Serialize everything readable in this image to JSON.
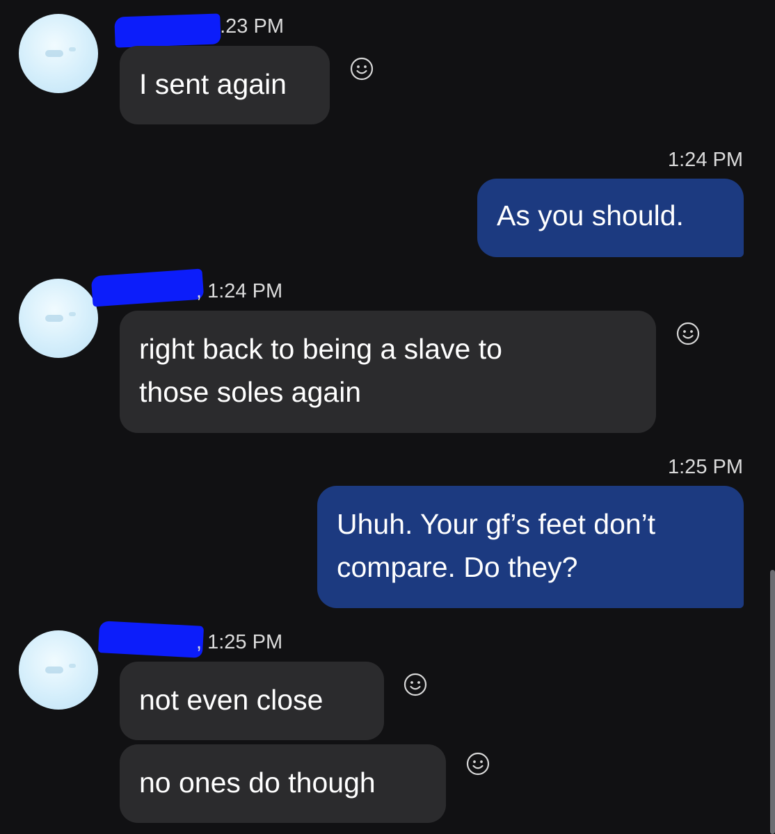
{
  "messages": [
    {
      "direction": "incoming",
      "time": "1:23 PM",
      "time_visible": "  .23 PM",
      "text": "I sent again"
    },
    {
      "direction": "outgoing",
      "time": "1:24 PM",
      "text": "As you should."
    },
    {
      "direction": "incoming",
      "time": "1:24 PM",
      "time_visible": ", 1:24 PM",
      "text_line1": "right back to being a slave to",
      "text_line2": "those soles again"
    },
    {
      "direction": "outgoing",
      "time": "1:25 PM",
      "text_line1": "Uhuh. Your gf’s feet don’t",
      "text_line2": "compare. Do they?"
    },
    {
      "direction": "incoming",
      "time": "1:25 PM",
      "time_visible": ", 1:25 PM",
      "text": "not even close"
    },
    {
      "direction": "incoming",
      "text": "no ones do though"
    }
  ],
  "icons": {
    "react": "smiley-face-icon",
    "avatar": "contact-avatar",
    "redaction": "blue-scribble-redaction"
  },
  "colors": {
    "background": "#111113",
    "incoming_bubble": "#2b2b2d",
    "outgoing_bubble": "#1c3a80",
    "redaction": "#0c1dfa",
    "avatar": "#d4eefb"
  }
}
